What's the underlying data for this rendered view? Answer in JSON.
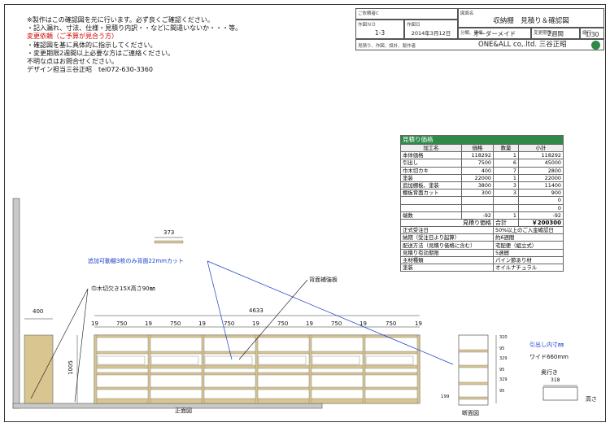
{
  "notes": {
    "lines": [
      "※製作はこの確認図を元に行います。必ず良くご確認ください。",
      "・記入漏れ、寸法、仕様・見積り内訳・・などに間違いないか・・・等。",
      "変更依頼（ご予算が見合う方）",
      "・確認図を基に具体的に指示してください。",
      "・変更期限2週間以上必要な方はご連絡ください。",
      "不明な点はお問合せください。",
      "デザイン担当三谷正昭　tel072-630-3360"
    ]
  },
  "title_block": {
    "customer_caption": "ご依頼者C",
    "drawing_caption": "図面名",
    "drawing_name": "収納棚　見積り＆確認図",
    "no_caption": "作図ＮＯ",
    "no_value": "1-3",
    "date_caption": "作図日",
    "date_value": "2014年3月12日",
    "class_caption": "分類、専業",
    "class_value": "オーダーメイド",
    "period_caption": "変更期限",
    "period_value": "2週間",
    "scale_caption": "縮尺",
    "scale_value": "1/30",
    "maker_caption": "見積り、作図、設計、製作者",
    "maker_value": "ONE&ALL co,.ltd.  三谷正昭"
  },
  "estimate": {
    "title": "見積り価格",
    "headers": [
      "加工名",
      "価格",
      "数量",
      "小計"
    ],
    "rows": [
      [
        "本体価格",
        "118292",
        "1",
        "118292"
      ],
      [
        "引出し",
        "7500",
        "6",
        "45000"
      ],
      [
        "巾木切カキ",
        "400",
        "7",
        "2800"
      ],
      [
        "塗装",
        "22000",
        "1",
        "22000"
      ],
      [
        "追加棚板、塗装",
        "3800",
        "3",
        "11400"
      ],
      [
        "棚板背面カット",
        "300",
        "3",
        "900"
      ],
      [
        "",
        "",
        "",
        "0"
      ],
      [
        "",
        "",
        "",
        "0"
      ],
      [
        "端数",
        "-92",
        "1",
        "-92"
      ]
    ],
    "total_label": "見積り価格",
    "total_caption": "合計",
    "total_value": "￥200300",
    "conditions": [
      [
        "正式受注日",
        "50%以上のご入金確認日"
      ],
      [
        "納期（受注日より起算）",
        "約6週間"
      ],
      [
        "配送方法（見積り価格に含む）",
        "宅配便（組立式）"
      ],
      [
        "見積り有効期限",
        "5週間"
      ],
      [
        "主材種類",
        "パイン節あり材"
      ],
      [
        "塗装",
        "オイルナチュラル"
      ]
    ]
  },
  "drawing": {
    "dim_373": "373",
    "dim_400": "400",
    "dim_1005": "1005",
    "dim_4633": "4633",
    "dim_19": "19",
    "dim_750": "750",
    "dim_318": "318",
    "dim_199": "199",
    "side_dims": [
      "320",
      "95",
      "329",
      "95",
      "329",
      "95"
    ],
    "note_extra_shelf": "追加可動棚3枚のみ背面22mmカット",
    "note_skirting": "巾木切欠き15X高さ90㎜",
    "note_back_board": "背面補強板",
    "note_drawer_inner": "引出し内寸㎜",
    "note_width": "ワイド660mm",
    "note_depth": "奥行き",
    "note_height": "高さ",
    "front_view": "正面図",
    "section_view": "断面図"
  }
}
